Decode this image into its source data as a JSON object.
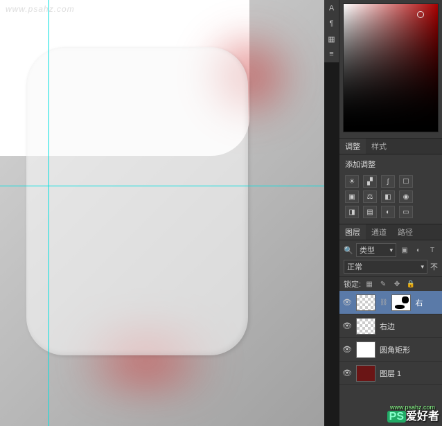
{
  "watermark": {
    "url": "www.psahz.com",
    "logo_ps": "PS",
    "logo_text": "爱好者"
  },
  "adjustments": {
    "tabs": {
      "adjust": "调整",
      "styles": "样式"
    },
    "title": "添加调整"
  },
  "layers": {
    "tabs": {
      "layers": "图层",
      "channels": "通道",
      "paths": "路径"
    },
    "filter_label": "类型",
    "blend_mode": "正常",
    "opacity_suffix": "不",
    "lock_label": "锁定:",
    "items": [
      {
        "name": "右",
        "selected": true,
        "thumb": "checker",
        "mask": true
      },
      {
        "name": "右边",
        "selected": false,
        "thumb": "checker",
        "mask": false
      },
      {
        "name": "圆角矩形",
        "selected": false,
        "thumb": "white",
        "mask": false
      },
      {
        "name": "图层 1",
        "selected": false,
        "thumb": "red",
        "mask": false
      }
    ]
  },
  "icons": {
    "search": "🔍"
  }
}
